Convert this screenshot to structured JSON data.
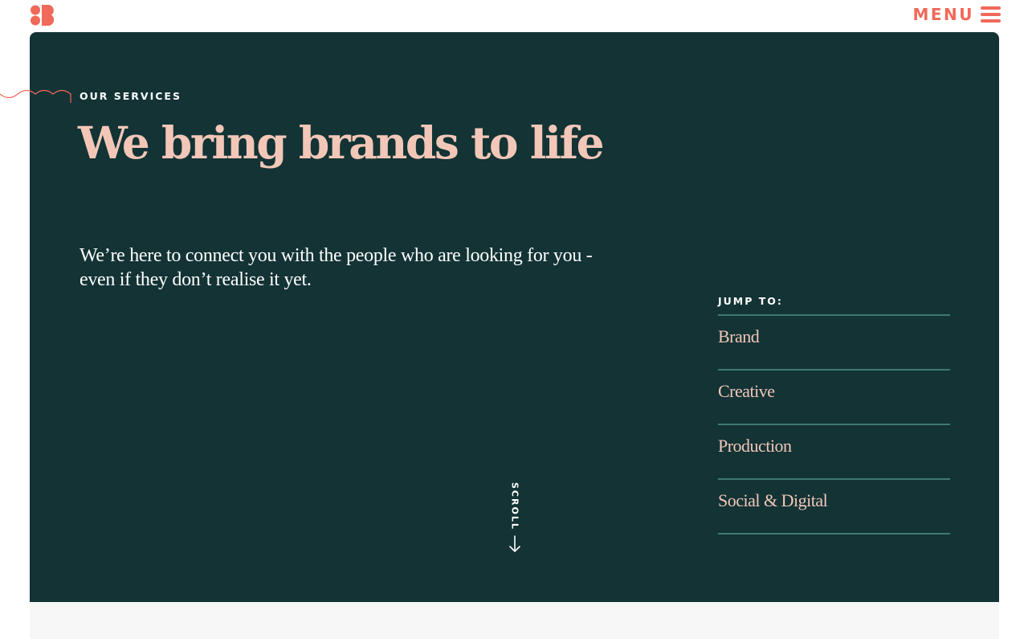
{
  "header": {
    "logo_name": "brand-logo",
    "menu_label": "MENU",
    "menu_icon": "hamburger-icon",
    "accent_color": "#f0695a"
  },
  "hero": {
    "background_color": "#133335",
    "heading_color": "#f2c7b8",
    "eyebrow": "OUR SERVICES",
    "title": "We bring brands to life",
    "intro": "We’re here to connect you with the people who are looking for you - even if they don’t realise it yet."
  },
  "jump_to": {
    "label": "JUMP TO:",
    "items": [
      {
        "label": "Brand"
      },
      {
        "label": "Creative"
      },
      {
        "label": "Production"
      },
      {
        "label": "Social & Digital"
      }
    ]
  },
  "scroll": {
    "label": "SCROLL",
    "icon": "arrow-down-icon"
  }
}
